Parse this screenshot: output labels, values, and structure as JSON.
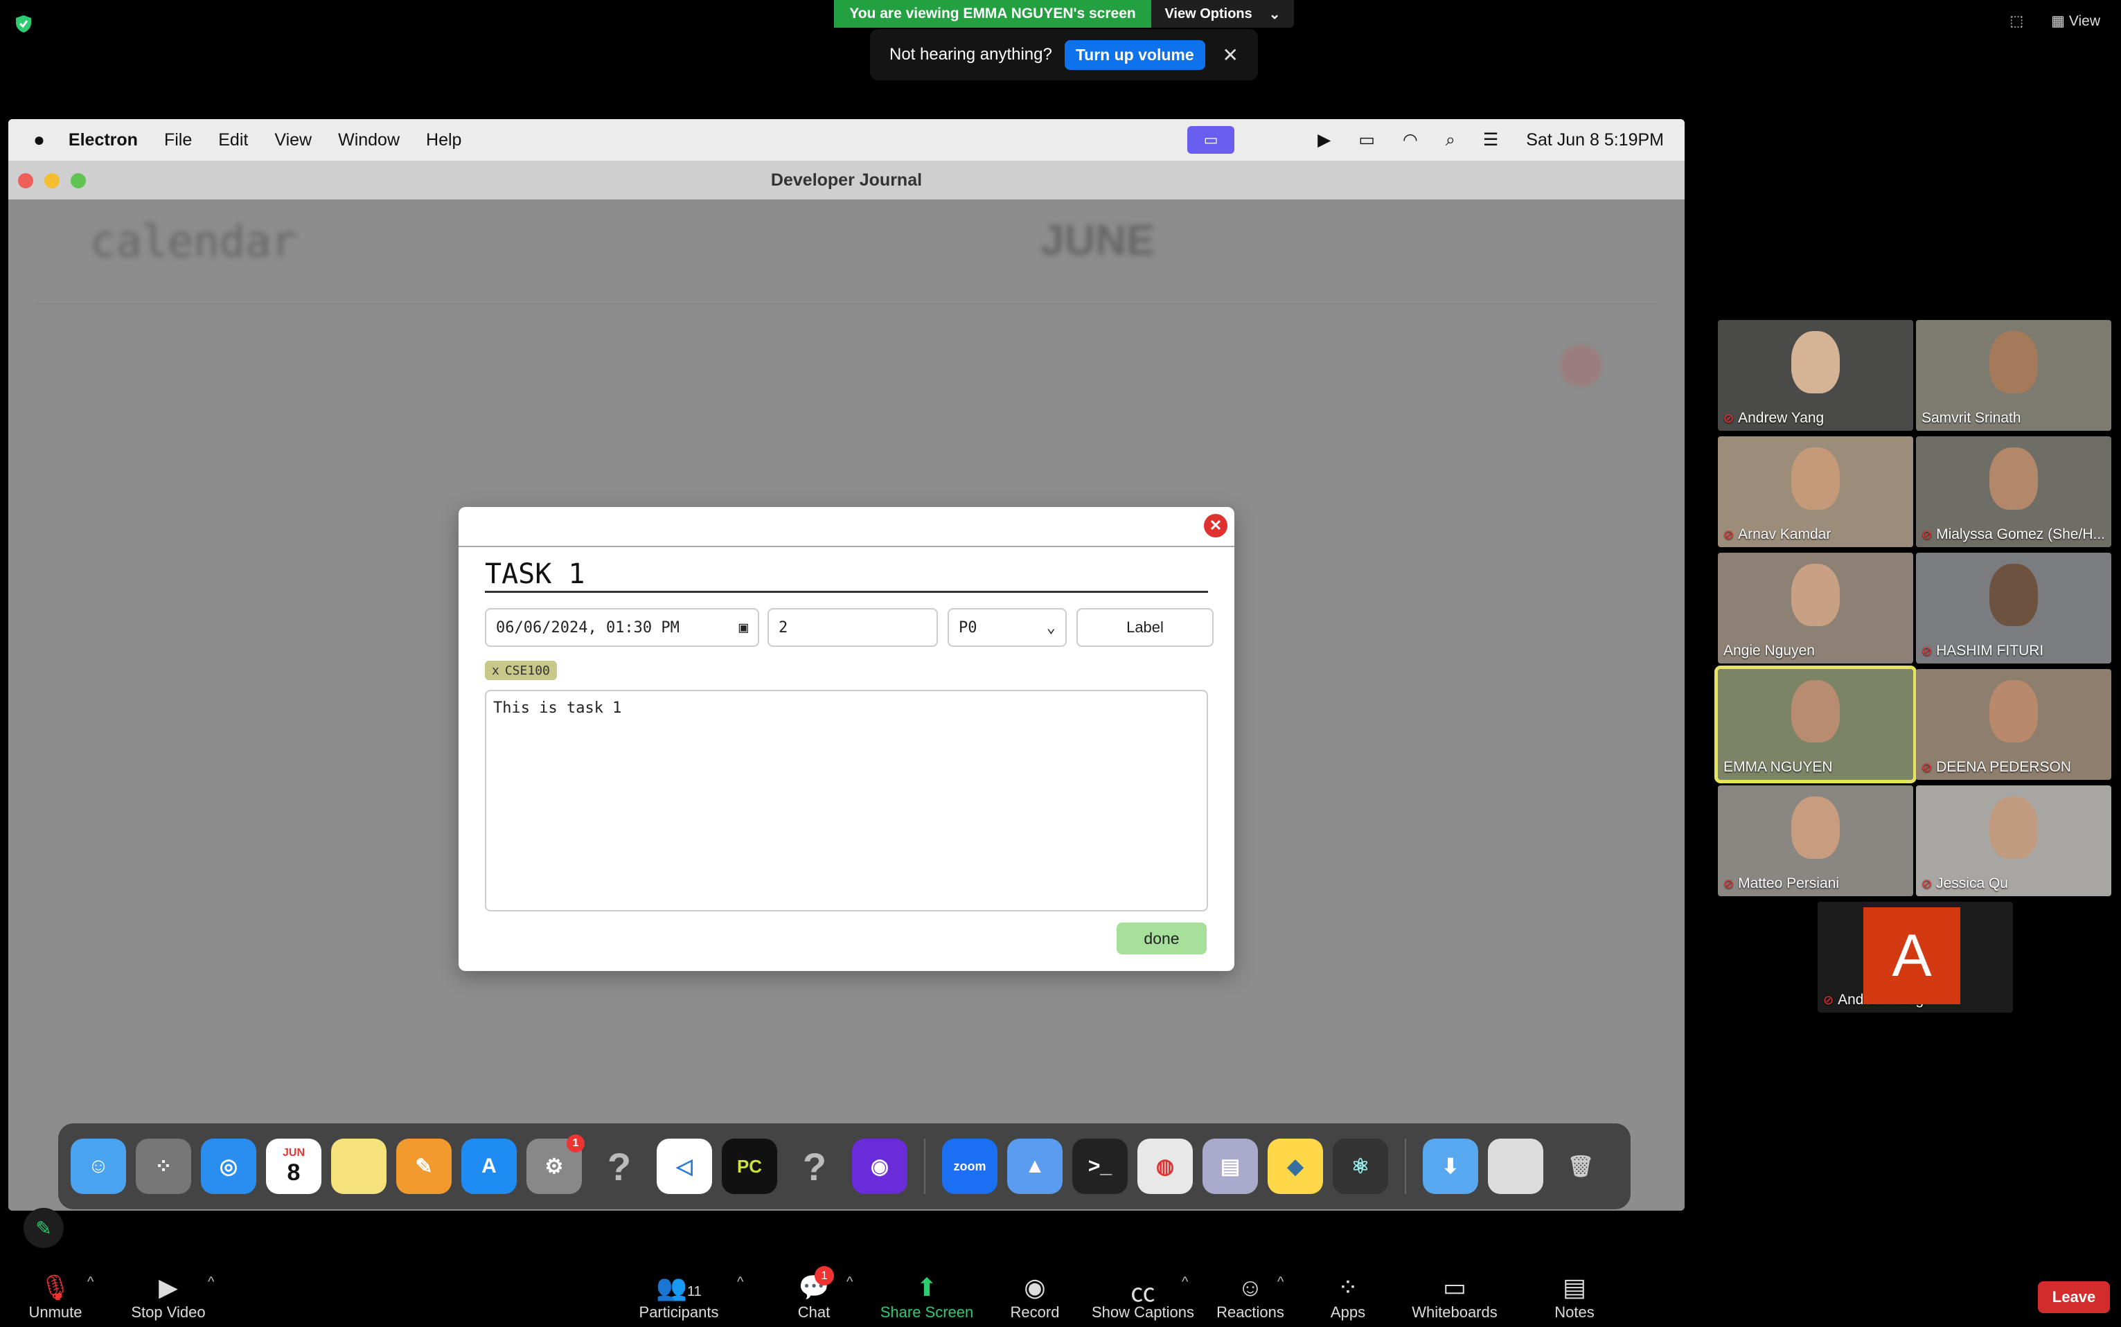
{
  "zoom": {
    "viewing_banner": "You are viewing EMMA NGUYEN's screen",
    "view_options": "View Options",
    "toast_text": "Not hearing anything?",
    "toast_button": "Turn up volume",
    "top_right_view": "View"
  },
  "mac": {
    "menus": [
      "Electron",
      "File",
      "Edit",
      "View",
      "Window",
      "Help"
    ],
    "datetime": "Sat Jun 8  5:19PM"
  },
  "app": {
    "window_title": "Developer Journal",
    "bg_title": "calendar",
    "bg_month": "JUNE"
  },
  "modal": {
    "title": "TASK 1",
    "datetime_value": "06/06/2024, 01:30 PM",
    "number_value": "2",
    "priority_value": "P0",
    "label_button": "Label",
    "tag": "CSE100",
    "tag_remove": "x",
    "description": "This is task 1",
    "done_button": "done"
  },
  "dock": {
    "calendar_month": "JUN",
    "calendar_day": "8",
    "settings_badge": "1"
  },
  "participants": [
    {
      "name": "Andrew Yang",
      "muted": true
    },
    {
      "name": "Samvrit Srinath",
      "muted": false
    },
    {
      "name": "Arnav Kamdar",
      "muted": true
    },
    {
      "name": "Mialyssa Gomez (She/H...",
      "muted": true
    },
    {
      "name": "Angie Nguyen",
      "muted": false
    },
    {
      "name": "HASHIM FITURI",
      "muted": true
    },
    {
      "name": "EMMA NGUYEN",
      "muted": false
    },
    {
      "name": "DEENA PEDERSON",
      "muted": true
    },
    {
      "name": "Matteo Persiani",
      "muted": true
    },
    {
      "name": "Jessica Qu",
      "muted": true
    }
  ],
  "avatar_tile": {
    "letter": "A",
    "name": "Andrew Yang"
  },
  "toolbar": {
    "unmute": "Unmute",
    "stop_video": "Stop Video",
    "participants": "Participants",
    "participants_count": "11",
    "chat": "Chat",
    "chat_badge": "1",
    "share_screen": "Share Screen",
    "record": "Record",
    "captions": "Show Captions",
    "reactions": "Reactions",
    "apps": "Apps",
    "whiteboards": "Whiteboards",
    "notes": "Notes",
    "leave": "Leave"
  }
}
